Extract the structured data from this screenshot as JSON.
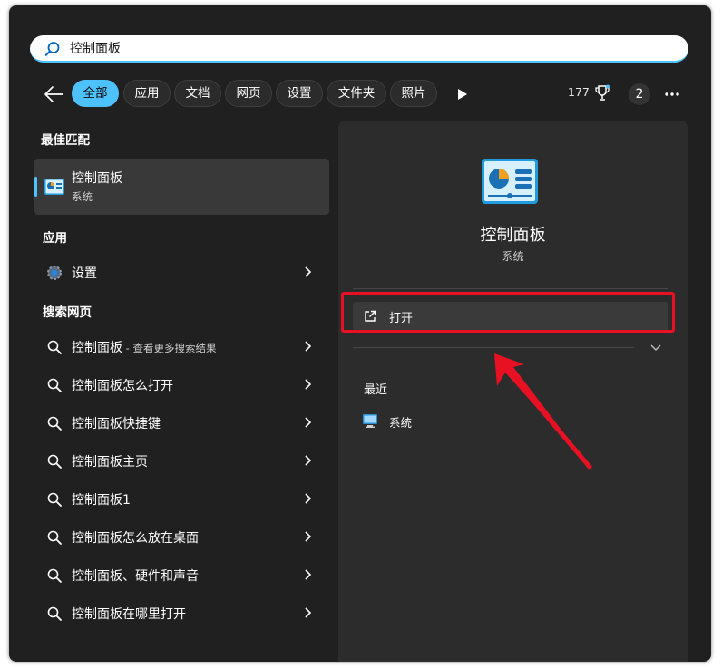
{
  "search": {
    "value": "控制面板"
  },
  "filters": {
    "chips": [
      "全部",
      "应用",
      "文档",
      "网页",
      "设置",
      "文件夹",
      "照片"
    ],
    "points": "177",
    "badge_count": "2"
  },
  "left": {
    "best_match_heading": "最佳匹配",
    "best_match": {
      "title": "控制面板",
      "subtitle": "系统"
    },
    "apps_heading": "应用",
    "apps": [
      {
        "label": "设置"
      }
    ],
    "web_heading": "搜索网页",
    "web_results": [
      {
        "label": "控制面板",
        "suffix": " - 查看更多搜索结果"
      },
      {
        "label": "控制面板怎么打开",
        "suffix": ""
      },
      {
        "label": "控制面板快捷键",
        "suffix": ""
      },
      {
        "label": "控制面板主页",
        "suffix": ""
      },
      {
        "label": "控制面板1",
        "suffix": ""
      },
      {
        "label": "控制面板怎么放在桌面",
        "suffix": ""
      },
      {
        "label": "控制面板、硬件和声音",
        "suffix": ""
      },
      {
        "label": "控制面板在哪里打开",
        "suffix": ""
      }
    ]
  },
  "preview": {
    "title": "控制面板",
    "subtitle": "系统",
    "open_label": "打开",
    "recent_heading": "最近",
    "recent_items": [
      {
        "label": "系统"
      }
    ]
  },
  "colors": {
    "accent": "#4cc2ff",
    "highlight": "#e81123",
    "panel": "#2c2c2c",
    "background": "#202020"
  },
  "icons": [
    "search-icon",
    "back-arrow-icon",
    "play-icon",
    "trophy-icon",
    "more-icon",
    "control-panel-icon",
    "gear-icon",
    "chevron-right-icon",
    "external-link-icon",
    "chevron-down-icon",
    "system-icon"
  ]
}
